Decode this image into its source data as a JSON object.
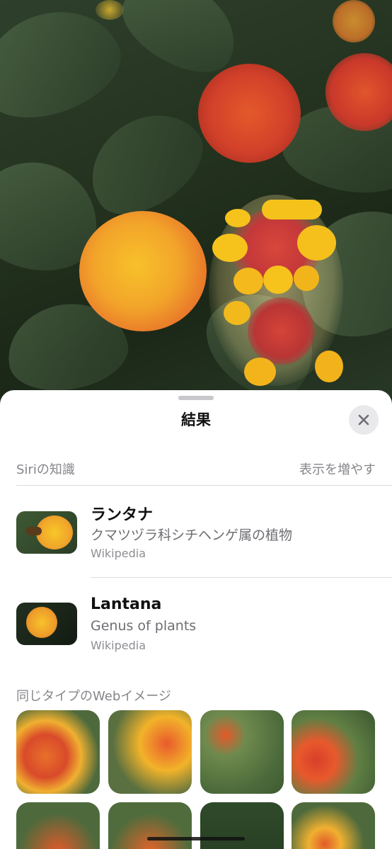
{
  "sheet": {
    "title": "結果",
    "close_icon": "close-icon"
  },
  "siri": {
    "section_label": "Siriの知識",
    "more_label": "表示を増やす"
  },
  "results": [
    {
      "title": "ランタナ",
      "subtitle": "クマツヅラ科シチヘンゲ属の植物",
      "source": "Wikipedia"
    },
    {
      "title": "Lantana",
      "subtitle": "Genus of plants",
      "source": "Wikipedia"
    }
  ],
  "web_images": {
    "section_label": "同じタイプのWebイメージ"
  },
  "colors": {
    "accent_orange": "#f29a1f",
    "bloom_red": "#d9432a",
    "bloom_yellow": "#f6c21c",
    "sheet_bg": "#ffffff",
    "secondary_text": "#86868b"
  }
}
